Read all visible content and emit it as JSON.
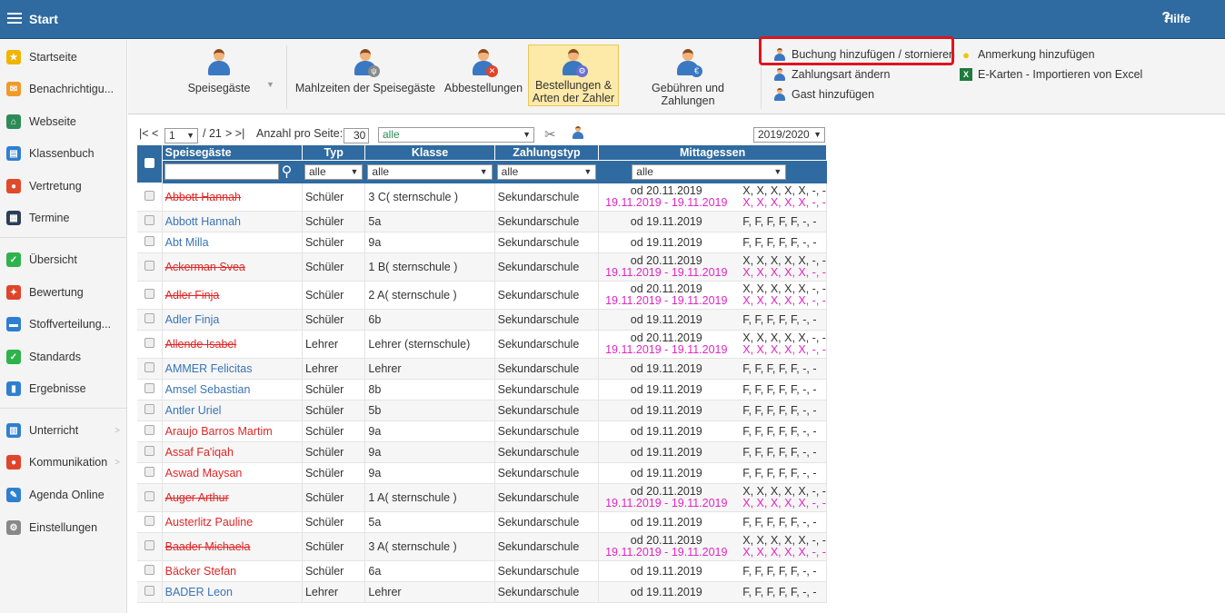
{
  "topbar": {
    "title": "Start",
    "help": "Hilfe",
    "help_icon": "?"
  },
  "sidebar": {
    "items": [
      {
        "label": "Startseite",
        "icon": "star-icon",
        "color": "#f0b400"
      },
      {
        "label": "Benachrichtigu...",
        "icon": "envelope-icon",
        "color": "#f09a2a"
      },
      {
        "label": "Webseite",
        "icon": "home-icon",
        "color": "#2e8b57"
      },
      {
        "label": "Klassenbuch",
        "icon": "book-icon",
        "color": "#2f7fd1"
      },
      {
        "label": "Vertretung",
        "icon": "person-swap-icon",
        "color": "#e04a2a"
      },
      {
        "label": "Termine",
        "icon": "calendar-icon",
        "color": "#2c3e57"
      },
      {
        "label": "Übersicht",
        "icon": "check-circle-icon",
        "color": "#2eb34a"
      },
      {
        "label": "Bewertung",
        "icon": "rating-icon",
        "color": "#e0442a"
      },
      {
        "label": "Stoffverteilung...",
        "icon": "briefcase-icon",
        "color": "#2f7fd1"
      },
      {
        "label": "Standards",
        "icon": "shield-icon",
        "color": "#2eb34a"
      },
      {
        "label": "Ergebnisse",
        "icon": "bar-chart-icon",
        "color": "#2f7fd1"
      },
      {
        "label": "Unterricht",
        "icon": "open-book-icon",
        "color": "#2f7fd1"
      },
      {
        "label": "Kommunikation",
        "icon": "chat-icon",
        "color": "#e0442a"
      },
      {
        "label": "Agenda Online",
        "icon": "pen-icon",
        "color": "#2f7fd1"
      },
      {
        "label": "Einstellungen",
        "icon": "gear-icon",
        "color": "#888888"
      }
    ]
  },
  "ribbon": {
    "buttons": [
      {
        "label1": "Speisegäste",
        "label2": ""
      },
      {
        "label1": "Mahlzeiten der Speisegäste",
        "label2": ""
      },
      {
        "label1": "Abbestellungen",
        "label2": ""
      },
      {
        "label1": "Bestellungen &",
        "label2": "Arten der Zahler"
      },
      {
        "label1": "Gebühren und Zahlungen",
        "label2": ""
      }
    ],
    "links": {
      "booking": "Buchung hinzufügen / stornieren",
      "payment_type": "Zahlungsart ändern",
      "guest": "Gast hinzufügen",
      "note": "Anmerkung hinzufügen",
      "import": "E-Karten - Importieren von Excel"
    }
  },
  "pager": {
    "first": "|< <",
    "page": "1",
    "total": "/ 21",
    "next": "> >|",
    "per_page_label": "Anzahl pro Seite:",
    "per_page": "30",
    "filter": "alle",
    "year": "2019/2020"
  },
  "table": {
    "headers": [
      "Speisegäste",
      "Typ",
      "Klasse",
      "Zahlungstyp",
      "Mittagessen"
    ],
    "filters": {
      "typ": "alle",
      "klasse": "alle",
      "zahlung": "alle",
      "mittag": "alle"
    },
    "rows": [
      {
        "name": "Abbott Hannah",
        "style": "strike",
        "typ": "Schüler",
        "klasse": "3 C( sternschule )",
        "zahlung": "Sekundarschule",
        "od": "od 20.11.2019",
        "range": "19.11.2019 - 19.11.2019",
        "days": "X, X, X, X, X, -, -",
        "days2": "X, X, X, X, X, -, -"
      },
      {
        "name": "Abbott Hannah",
        "style": "blue",
        "typ": "Schüler",
        "klasse": "5a",
        "zahlung": "Sekundarschule",
        "od": "od 19.11.2019",
        "range": "",
        "days": "F, F, F, F, F, -, -",
        "days2": ""
      },
      {
        "name": "Abt Milla",
        "style": "blue",
        "typ": "Schüler",
        "klasse": "9a",
        "zahlung": "Sekundarschule",
        "od": "od 19.11.2019",
        "range": "",
        "days": "F, F, F, F, F, -, -",
        "days2": ""
      },
      {
        "name": "Ackerman Svea",
        "style": "strike",
        "typ": "Schüler",
        "klasse": "1 B( sternschule )",
        "zahlung": "Sekundarschule",
        "od": "od 20.11.2019",
        "range": "19.11.2019 - 19.11.2019",
        "days": "X, X, X, X, X, -, -",
        "days2": "X, X, X, X, X, -, -"
      },
      {
        "name": "Adler Finja",
        "style": "strike",
        "typ": "Schüler",
        "klasse": "2 A( sternschule )",
        "zahlung": "Sekundarschule",
        "od": "od 20.11.2019",
        "range": "19.11.2019 - 19.11.2019",
        "days": "X, X, X, X, X, -, -",
        "days2": "X, X, X, X, X, -, -"
      },
      {
        "name": "Adler Finja",
        "style": "blue",
        "typ": "Schüler",
        "klasse": "6b",
        "zahlung": "Sekundarschule",
        "od": "od 19.11.2019",
        "range": "",
        "days": "F, F, F, F, F, -, -",
        "days2": ""
      },
      {
        "name": "Allende Isabel",
        "style": "strike",
        "typ": "Lehrer",
        "klasse": "Lehrer (sternschule)",
        "zahlung": "Sekundarschule",
        "od": "od 20.11.2019",
        "range": "19.11.2019 - 19.11.2019",
        "days": "X, X, X, X, X, -, -",
        "days2": "X, X, X, X, X, -, -"
      },
      {
        "name": "AMMER Felicitas",
        "style": "blue",
        "typ": "Lehrer",
        "klasse": "Lehrer",
        "zahlung": "Sekundarschule",
        "od": "od 19.11.2019",
        "range": "",
        "days": "F, F, F, F, F, -, -",
        "days2": ""
      },
      {
        "name": "Amsel Sebastian",
        "style": "blue",
        "typ": "Schüler",
        "klasse": "8b",
        "zahlung": "Sekundarschule",
        "od": "od 19.11.2019",
        "range": "",
        "days": "F, F, F, F, F, -, -",
        "days2": ""
      },
      {
        "name": "Antler Uriel",
        "style": "blue",
        "typ": "Schüler",
        "klasse": "5b",
        "zahlung": "Sekundarschule",
        "od": "od 19.11.2019",
        "range": "",
        "days": "F, F, F, F, F, -, -",
        "days2": ""
      },
      {
        "name": "Araujo Barros Martim",
        "style": "red",
        "typ": "Schüler",
        "klasse": "9a",
        "zahlung": "Sekundarschule",
        "od": "od 19.11.2019",
        "range": "",
        "days": "F, F, F, F, F, -, -",
        "days2": ""
      },
      {
        "name": "Assaf Fa'iqah",
        "style": "red",
        "typ": "Schüler",
        "klasse": "9a",
        "zahlung": "Sekundarschule",
        "od": "od 19.11.2019",
        "range": "",
        "days": "F, F, F, F, F, -, -",
        "days2": ""
      },
      {
        "name": "Aswad Maysan",
        "style": "red",
        "typ": "Schüler",
        "klasse": "9a",
        "zahlung": "Sekundarschule",
        "od": "od 19.11.2019",
        "range": "",
        "days": "F, F, F, F, F, -, -",
        "days2": ""
      },
      {
        "name": "Auger Arthur",
        "style": "strike",
        "typ": "Schüler",
        "klasse": "1 A( sternschule )",
        "zahlung": "Sekundarschule",
        "od": "od 20.11.2019",
        "range": "19.11.2019 - 19.11.2019",
        "days": "X, X, X, X, X, -, -",
        "days2": "X, X, X, X, X, -, -"
      },
      {
        "name": "Austerlitz Pauline",
        "style": "red",
        "typ": "Schüler",
        "klasse": "5a",
        "zahlung": "Sekundarschule",
        "od": "od 19.11.2019",
        "range": "",
        "days": "F, F, F, F, F, -, -",
        "days2": ""
      },
      {
        "name": "Baader Michaela",
        "style": "strike",
        "typ": "Schüler",
        "klasse": "3 A( sternschule )",
        "zahlung": "Sekundarschule",
        "od": "od 20.11.2019",
        "range": "19.11.2019 - 19.11.2019",
        "days": "X, X, X, X, X, -, -",
        "days2": "X, X, X, X, X, -, -"
      },
      {
        "name": "Bäcker Stefan",
        "style": "red",
        "typ": "Schüler",
        "klasse": "6a",
        "zahlung": "Sekundarschule",
        "od": "od 19.11.2019",
        "range": "",
        "days": "F, F, F, F, F, -, -",
        "days2": ""
      },
      {
        "name": "BADER Leon",
        "style": "blue",
        "typ": "Lehrer",
        "klasse": "Lehrer",
        "zahlung": "Sekundarschule",
        "od": "od 19.11.2019",
        "range": "",
        "days": "F, F, F, F, F, -, -",
        "days2": ""
      }
    ]
  }
}
